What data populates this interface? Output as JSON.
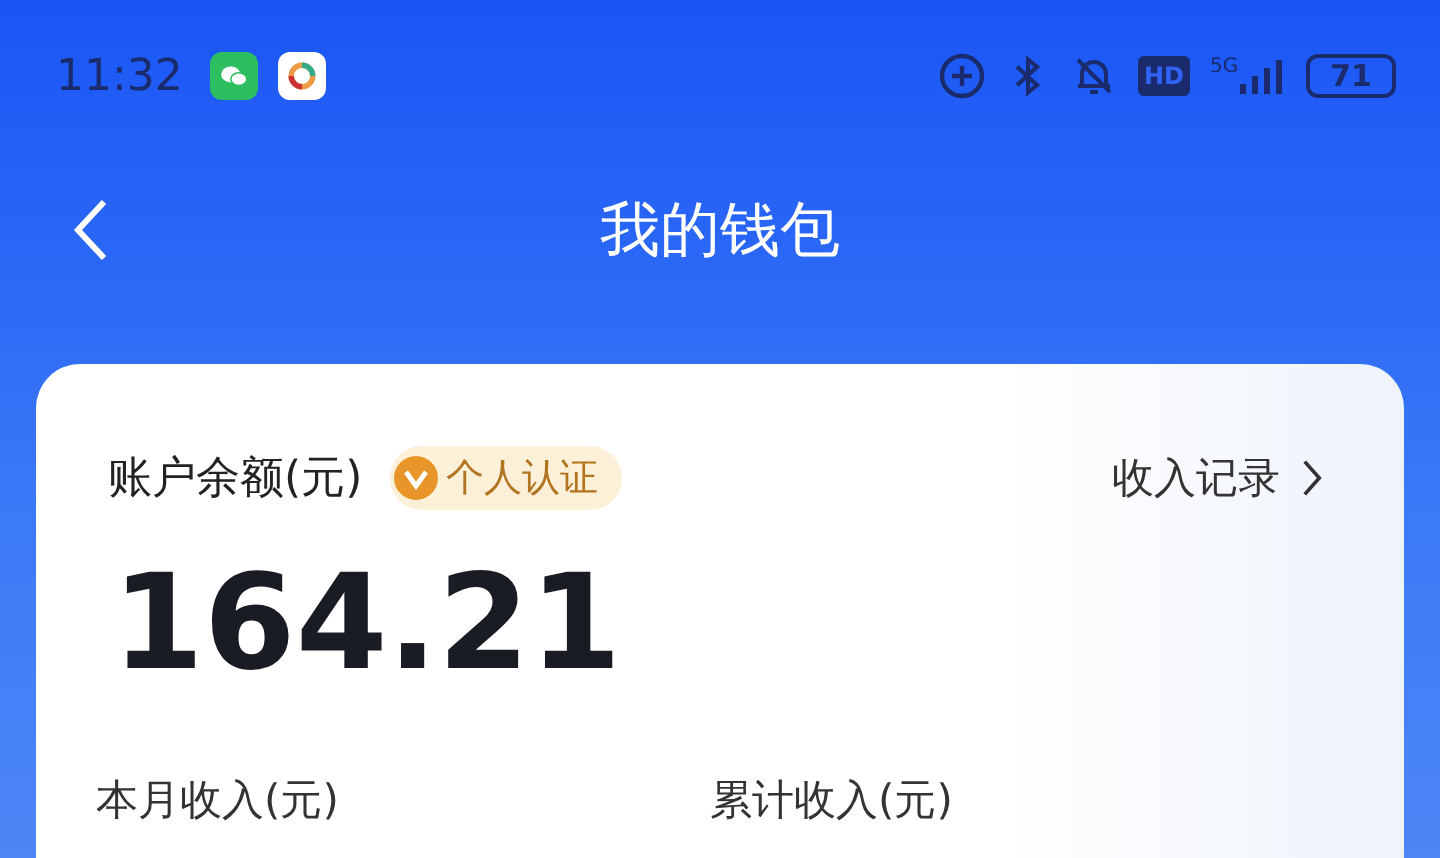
{
  "status_bar": {
    "time": "11:32",
    "network": "5G",
    "hd": "HD",
    "battery": "71"
  },
  "header": {
    "title": "我的钱包"
  },
  "card": {
    "balance_label": "账户余额(元)",
    "badge": "个人认证",
    "records_link": "收入记录",
    "balance": "164.21",
    "stats": [
      {
        "label": "本月收入(元)"
      },
      {
        "label": "累计收入(元)"
      }
    ]
  }
}
